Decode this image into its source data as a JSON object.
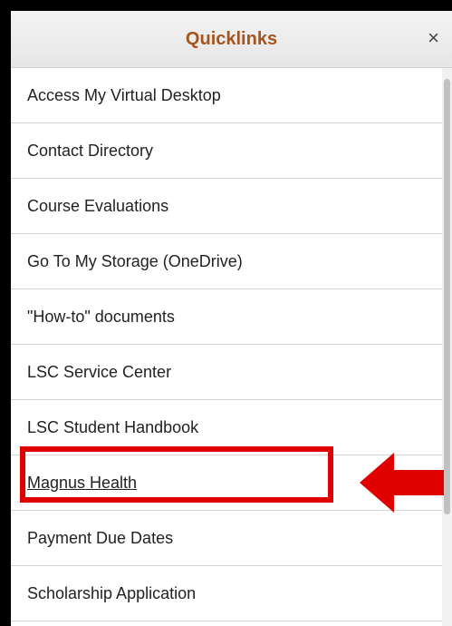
{
  "panel": {
    "title": "Quicklinks",
    "close_icon": "close-icon",
    "close_glyph": "×"
  },
  "colors": {
    "title": "#a55420",
    "annotation_red": "#e00000"
  },
  "items": [
    {
      "label": "Access My Virtual Desktop"
    },
    {
      "label": "Contact Directory"
    },
    {
      "label": "Course Evaluations"
    },
    {
      "label": "Go To My Storage (OneDrive)"
    },
    {
      "label": "\"How-to\" documents"
    },
    {
      "label": "LSC Service Center"
    },
    {
      "label": "LSC Student Handbook"
    },
    {
      "label": "Magnus Health"
    },
    {
      "label": "Payment Due Dates"
    },
    {
      "label": "Scholarship Application"
    }
  ]
}
